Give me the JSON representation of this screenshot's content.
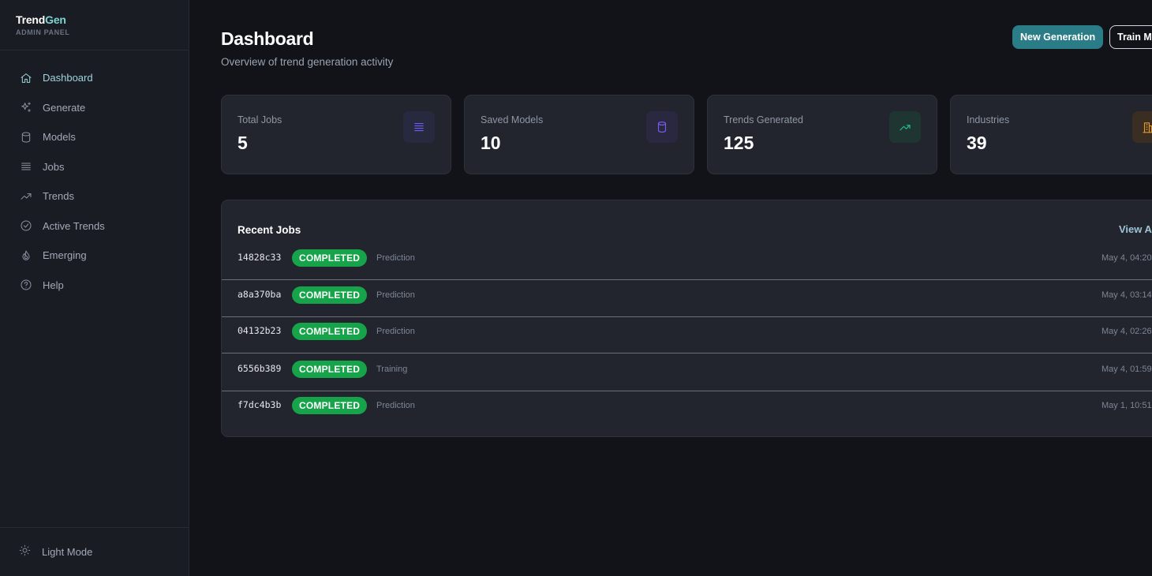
{
  "brand": {
    "name_main": "Trend",
    "name_accent": "Gen",
    "subtitle": "ADMIN PANEL"
  },
  "nav": {
    "items": [
      {
        "label": "Dashboard",
        "icon": "home-icon",
        "active": true
      },
      {
        "label": "Generate",
        "icon": "sparkles-icon"
      },
      {
        "label": "Models",
        "icon": "database-icon"
      },
      {
        "label": "Jobs",
        "icon": "stack-icon"
      },
      {
        "label": "Trends",
        "icon": "trending-up-icon"
      },
      {
        "label": "Active Trends",
        "icon": "check-circle-icon"
      },
      {
        "label": "Emerging",
        "icon": "flame-icon"
      },
      {
        "label": "Help",
        "icon": "help-circle-icon"
      }
    ],
    "footer": {
      "label": "Light Mode",
      "icon": "sun-icon"
    }
  },
  "header": {
    "title": "Dashboard",
    "subtitle": "Overview of trend generation activity",
    "primary_button": "New Generation",
    "secondary_button": "Train M"
  },
  "stats": [
    {
      "label": "Total Jobs",
      "value": "5",
      "icon": "stack-icon",
      "color": "#6d5cf6",
      "icon_bg": "#272a3f"
    },
    {
      "label": "Saved Models",
      "value": "10",
      "icon": "database-icon",
      "color": "#7c5cf0",
      "icon_bg": "#292840"
    },
    {
      "label": "Trends Generated",
      "value": "125",
      "icon": "trending-up-icon",
      "color": "#22c58b",
      "icon_bg": "#1f3532"
    },
    {
      "label": "Industries",
      "value": "39",
      "icon": "building-icon",
      "color": "#e59a2b",
      "icon_bg": "#3a2e22"
    }
  ],
  "recent_jobs": {
    "title": "Recent Jobs",
    "view_all": "View Al",
    "rows": [
      {
        "id": "14828c33",
        "status": "COMPLETED",
        "type": "Prediction",
        "time": "May 4, 04:20"
      },
      {
        "id": "a8a370ba",
        "status": "COMPLETED",
        "type": "Prediction",
        "time": "May 4, 03:14"
      },
      {
        "id": "04132b23",
        "status": "COMPLETED",
        "type": "Prediction",
        "time": "May 4, 02:26"
      },
      {
        "id": "6556b389",
        "status": "COMPLETED",
        "type": "Training",
        "time": "May 4, 01:59"
      },
      {
        "id": "f7dc4b3b",
        "status": "COMPLETED",
        "type": "Prediction",
        "time": "May 1, 10:51"
      }
    ]
  },
  "colors": {
    "accent": "#2a7c86",
    "status_completed": "#16a34a",
    "background": "#121318",
    "card": "#22252e"
  }
}
